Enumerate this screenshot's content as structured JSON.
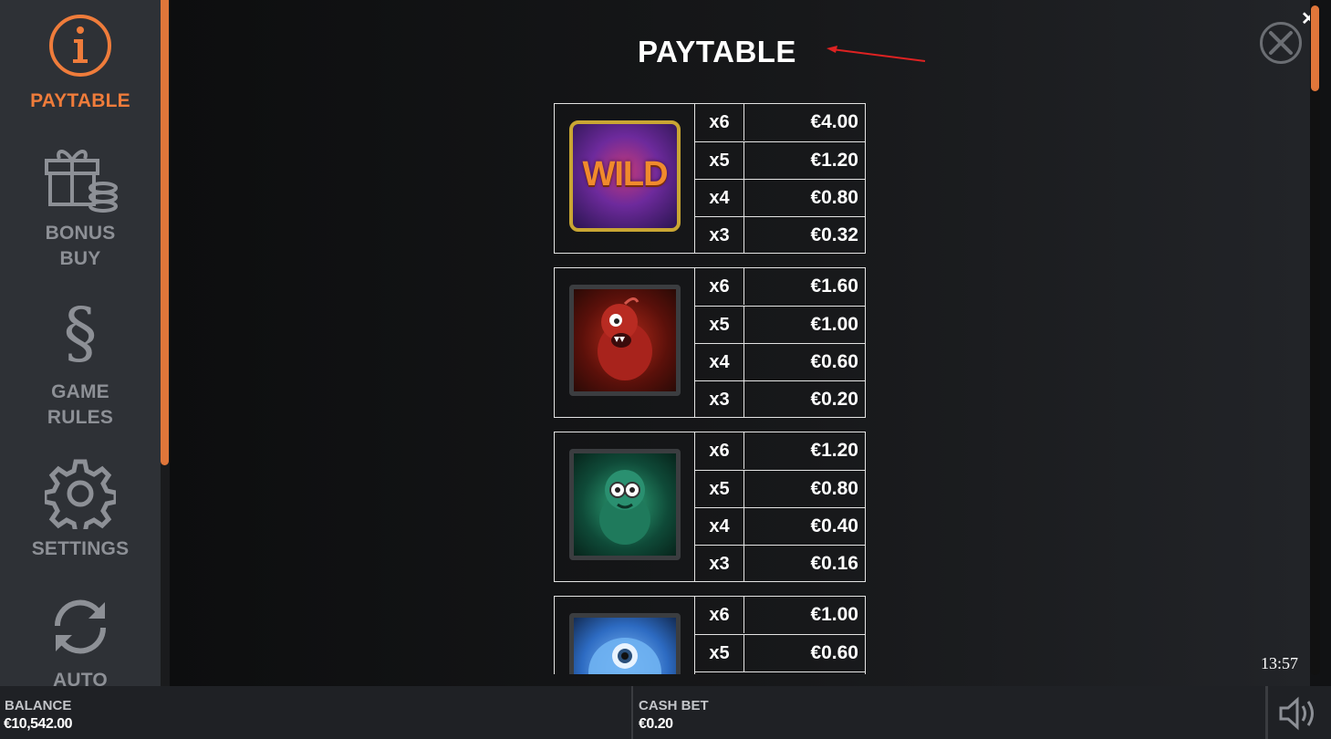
{
  "sidebar": {
    "items": [
      {
        "label": "PAYTABLE",
        "icon": "info-icon",
        "active": true
      },
      {
        "label": "BONUS BUY",
        "icon": "gift-coins-icon",
        "active": false
      },
      {
        "label": "GAME RULES",
        "icon": "section-sign-icon",
        "active": false
      },
      {
        "label": "SETTINGS",
        "icon": "gear-icon",
        "active": false
      },
      {
        "label": "AUTO",
        "icon": "refresh-icon",
        "active": false
      }
    ]
  },
  "header": {
    "title": "PAYTABLE",
    "close_symbol": "✕"
  },
  "paytable": [
    {
      "symbol": "wild",
      "wild_text": "WILD",
      "rows": [
        {
          "count": "x6",
          "amount": "€4.00"
        },
        {
          "count": "x5",
          "amount": "€1.20"
        },
        {
          "count": "x4",
          "amount": "€0.80"
        },
        {
          "count": "x3",
          "amount": "€0.32"
        }
      ]
    },
    {
      "symbol": "red-monster",
      "rows": [
        {
          "count": "x6",
          "amount": "€1.60"
        },
        {
          "count": "x5",
          "amount": "€1.00"
        },
        {
          "count": "x4",
          "amount": "€0.60"
        },
        {
          "count": "x3",
          "amount": "€0.20"
        }
      ]
    },
    {
      "symbol": "green-monster",
      "rows": [
        {
          "count": "x6",
          "amount": "€1.20"
        },
        {
          "count": "x5",
          "amount": "€0.80"
        },
        {
          "count": "x4",
          "amount": "€0.40"
        },
        {
          "count": "x3",
          "amount": "€0.16"
        }
      ]
    },
    {
      "symbol": "blue-monster",
      "rows": [
        {
          "count": "x6",
          "amount": "€1.00"
        },
        {
          "count": "x5",
          "amount": "€0.60"
        }
      ]
    }
  ],
  "clock": "13:57",
  "footer": {
    "balance_label": "BALANCE",
    "balance_value": "€10,542.00",
    "cash_bet_label": "CASH BET",
    "cash_bet_value": "€0.20",
    "sound_icon": "speaker-icon"
  },
  "colors": {
    "accent": "#ef7c3b",
    "sidebar_bg": "#2e3136",
    "muted": "#8d9096"
  }
}
